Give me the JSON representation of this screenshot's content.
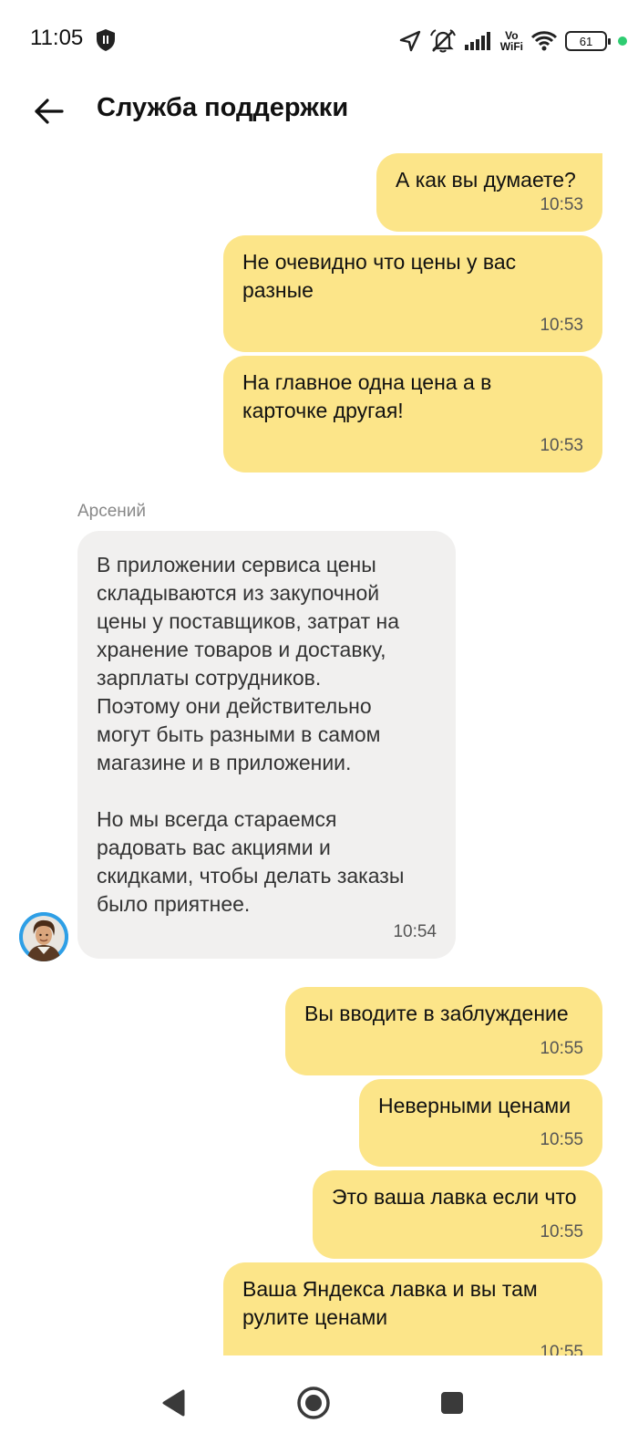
{
  "status_bar": {
    "time": "11:05",
    "vowifi_top": "Vo",
    "vowifi_bottom": "WiFi",
    "battery": "61",
    "dot_color": "#2ecc71"
  },
  "header": {
    "title": "Служба поддержки"
  },
  "chat": {
    "sender_name": "Арсений",
    "messages": [
      {
        "direction": "out",
        "text": "А как вы думаете?",
        "time": "10:53"
      },
      {
        "direction": "out",
        "text": "Не очевидно что цены у вас\nразные",
        "time": "10:53"
      },
      {
        "direction": "out",
        "text": "На главное одна цена а в\nкарточке другая!",
        "time": "10:53"
      },
      {
        "direction": "in",
        "text": "В приложении сервиса цены\nскладываются из закупочной\nцены у поставщиков, затрат на\nхранение товаров и доставку,\nзарплаты сотрудников.\nПоэтому они действительно\nмогут быть разными в самом\nмагазине и в приложении.\n\nНо мы всегда стараемся\nрадовать вас акциями и\nскидками, чтобы делать заказы\nбыло приятнее.",
        "time": "10:54"
      },
      {
        "direction": "out",
        "text": "Вы вводите в заблуждение",
        "time": "10:55"
      },
      {
        "direction": "out",
        "text": "Неверными ценами",
        "time": "10:55"
      },
      {
        "direction": "out",
        "text": "Это ваша лавка если что",
        "time": "10:55"
      },
      {
        "direction": "out",
        "text": "Ваша Яндекса лавка и вы там\nрулите ценами",
        "time": "10:55"
      }
    ]
  },
  "colors": {
    "outgoing_bubble": "#fce589",
    "incoming_bubble": "#f1f0ef",
    "avatar_ring": "#2e9fe6"
  }
}
